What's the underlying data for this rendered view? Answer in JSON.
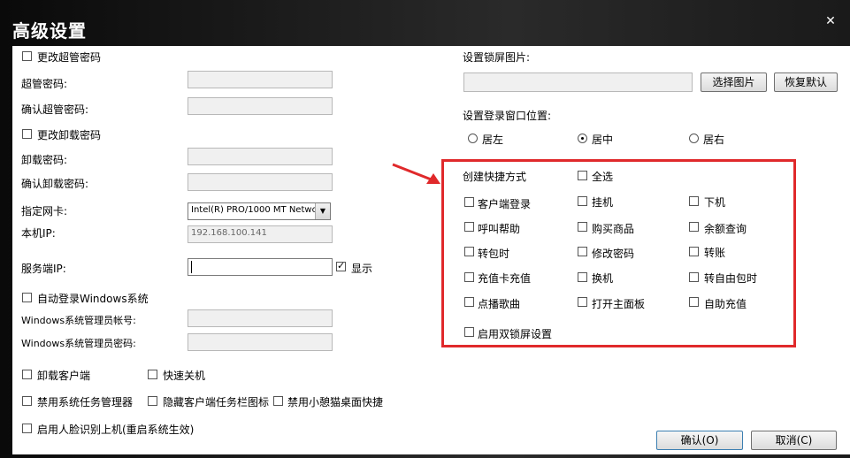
{
  "window": {
    "title": "高级设置"
  },
  "left": {
    "change_admin_pwd": "更改超管密码",
    "admin_pwd": "超管密码:",
    "confirm_admin_pwd": "确认超管密码:",
    "change_uninstall_pwd": "更改卸载密码",
    "uninstall_pwd": "卸载密码:",
    "confirm_uninstall_pwd": "确认卸载密码:",
    "nic_label": "指定网卡:",
    "nic_value": "Intel(R) PRO/1000 MT Networ",
    "local_ip_label": "本机IP:",
    "local_ip_value": "192.168.100.141",
    "server_ip_label": "服务端IP:",
    "show_label": "显示",
    "auto_login_windows": "自动登录Windows系统",
    "win_admin_account": "Windows系统管理员帐号:",
    "win_admin_pwd": "Windows系统管理员密码:",
    "uninstall_client": "卸载客户端",
    "fast_shutdown": "快速关机",
    "disable_task_mgr": "禁用系统任务管理器",
    "hide_taskbar_icon": "隐藏客户端任务栏图标",
    "disable_xiaoxiongmao": "禁用小憩猫桌面快捷",
    "face_login": "启用人脸识别上机(重启系统生效)"
  },
  "right": {
    "lock_image_label": "设置锁屏图片:",
    "choose_image": "选择图片",
    "restore_default": "恢复默认",
    "login_pos_label": "设置登录窗口位置:",
    "pos_left": "居左",
    "pos_center": "居中",
    "pos_right": "居右",
    "shortcut_title": "创建快捷方式",
    "select_all": "全选",
    "items": [
      "客户端登录",
      "挂机",
      "下机",
      "呼叫帮助",
      "购买商品",
      "余额查询",
      "转包时",
      "修改密码",
      "转账",
      "充值卡充值",
      "换机",
      "转自由包时",
      "点播歌曲",
      "打开主面板",
      "自助充值"
    ],
    "dual_lock": "启用双锁屏设置"
  },
  "footer": {
    "ok": "确认(O)",
    "cancel": "取消(C)"
  },
  "colors": {
    "highlight_box": "#e0292b",
    "arrow": "#e0292b"
  }
}
